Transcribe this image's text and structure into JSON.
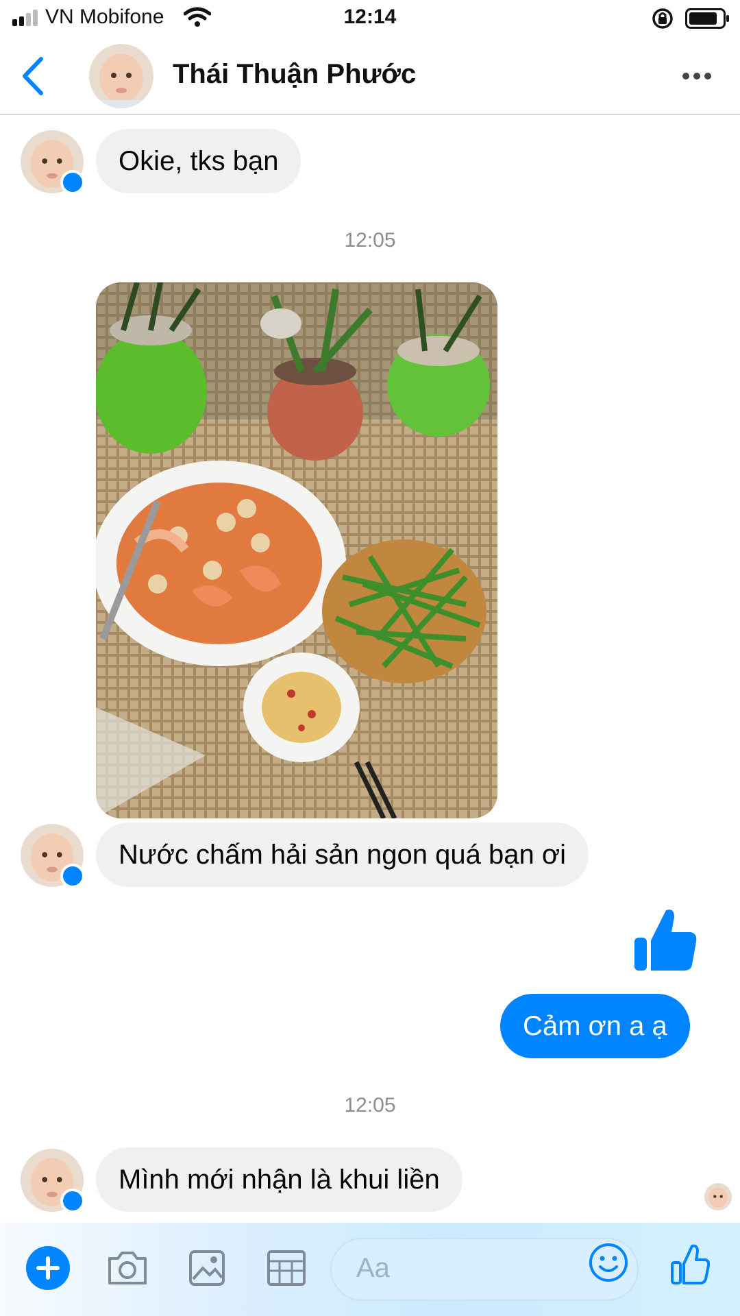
{
  "status_bar": {
    "carrier": "VN Mobifone",
    "time": "12:14"
  },
  "header": {
    "contact_name": "Thái Thuận Phước"
  },
  "messages": [
    {
      "type": "incoming",
      "text": "Okie, tks bạn"
    },
    {
      "type": "timestamp",
      "text": "12:05"
    },
    {
      "type": "incoming_photo",
      "description_icon": "photo-message"
    },
    {
      "type": "incoming",
      "text": "Nước chấm hải sản ngon quá bạn ơi"
    },
    {
      "type": "outgoing_like",
      "icon": "thumbs-up-icon"
    },
    {
      "type": "outgoing",
      "text": "Cảm ơn a ạ"
    },
    {
      "type": "timestamp",
      "text": "12:05"
    },
    {
      "type": "incoming",
      "text": "Mình mới nhận là khui liền"
    }
  ],
  "composer": {
    "placeholder": "Aa",
    "icons": [
      "plus-icon",
      "camera-icon",
      "gallery-icon",
      "sticker-icon",
      "emoji-icon",
      "like-icon"
    ]
  },
  "colors": {
    "accent": "#0084ff",
    "incoming_bubble": "#f0f0f0",
    "timestamp": "#8a8d91"
  }
}
